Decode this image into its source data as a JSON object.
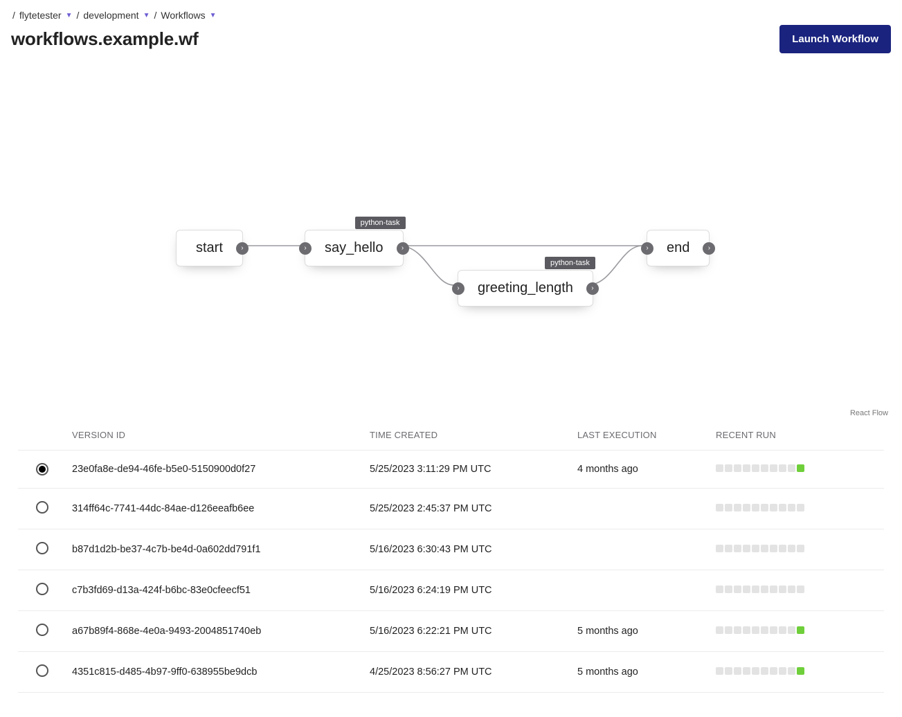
{
  "breadcrumb": {
    "items": [
      {
        "label": "flytetester"
      },
      {
        "label": "development"
      },
      {
        "label": "Workflows"
      }
    ]
  },
  "title": "workflows.example.wf",
  "launch_button_label": "Launch Workflow",
  "graph": {
    "nodes": {
      "start": {
        "label": "start",
        "tag": null
      },
      "say_hello": {
        "label": "say_hello",
        "tag": "python-task"
      },
      "greeting_length": {
        "label": "greeting_length",
        "tag": "python-task"
      },
      "end": {
        "label": "end",
        "tag": null
      }
    },
    "attribution": "React Flow"
  },
  "table": {
    "headers": {
      "version_id": "VERSION ID",
      "time_created": "TIME CREATED",
      "last_execution": "LAST EXECUTION",
      "recent_run": "RECENT RUN"
    },
    "rows": [
      {
        "selected": true,
        "version_id": "23e0fa8e-de94-46fe-b5e0-5150900d0f27",
        "time_created": "5/25/2023 3:11:29 PM UTC",
        "last_execution": "4 months ago",
        "recent_last_green": true
      },
      {
        "selected": false,
        "version_id": "314ff64c-7741-44dc-84ae-d126eeafb6ee",
        "time_created": "5/25/2023 2:45:37 PM UTC",
        "last_execution": "",
        "recent_last_green": false
      },
      {
        "selected": false,
        "version_id": "b87d1d2b-be37-4c7b-be4d-0a602dd791f1",
        "time_created": "5/16/2023 6:30:43 PM UTC",
        "last_execution": "",
        "recent_last_green": false
      },
      {
        "selected": false,
        "version_id": "c7b3fd69-d13a-424f-b6bc-83e0cfeecf51",
        "time_created": "5/16/2023 6:24:19 PM UTC",
        "last_execution": "",
        "recent_last_green": false
      },
      {
        "selected": false,
        "version_id": "a67b89f4-868e-4e0a-9493-2004851740eb",
        "time_created": "5/16/2023 6:22:21 PM UTC",
        "last_execution": "5 months ago",
        "recent_last_green": true
      },
      {
        "selected": false,
        "version_id": "4351c815-d485-4b97-9ff0-638955be9dcb",
        "time_created": "4/25/2023 8:56:27 PM UTC",
        "last_execution": "5 months ago",
        "recent_last_green": true
      }
    ]
  }
}
